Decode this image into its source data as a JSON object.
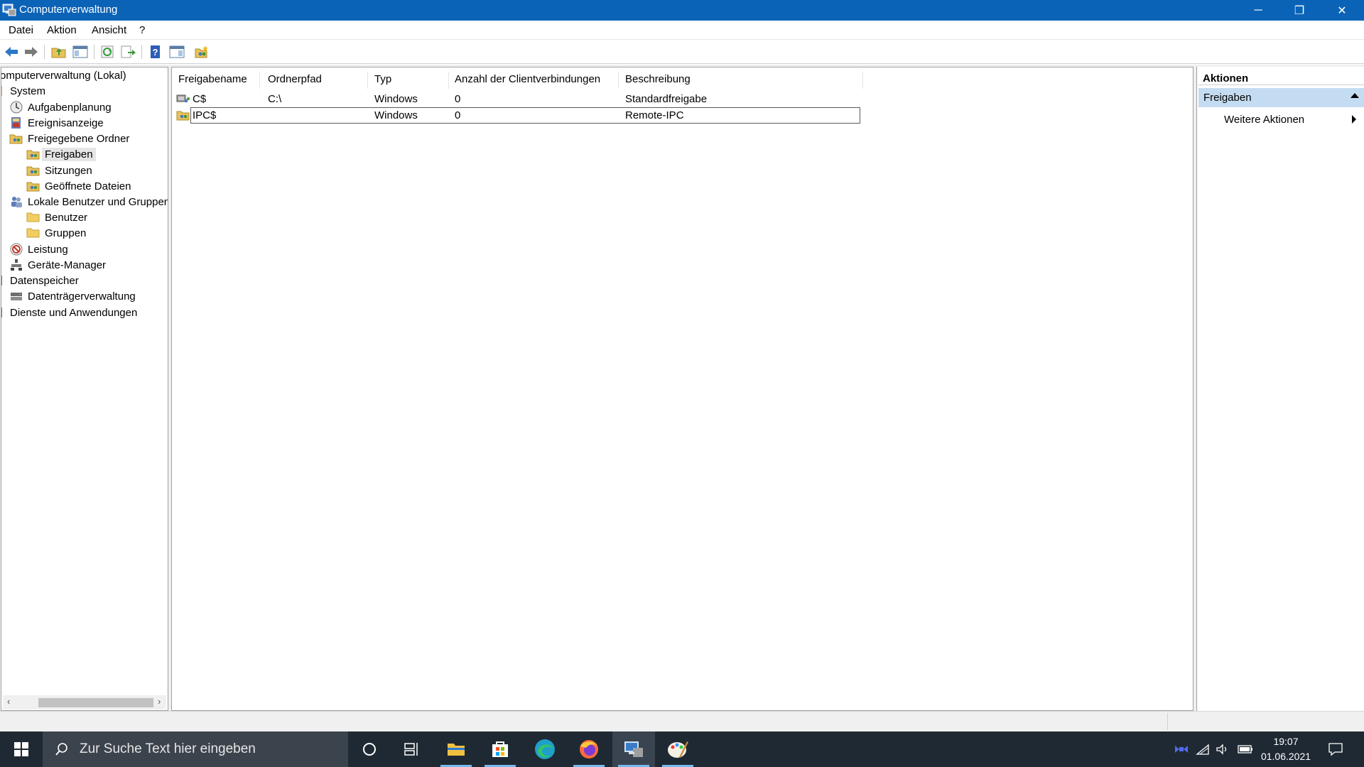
{
  "window": {
    "title": "Computerverwaltung",
    "controls": {
      "minimize": "─",
      "restore": "❐",
      "close": "✕"
    }
  },
  "menu": [
    "Datei",
    "Aktion",
    "Ansicht",
    "?"
  ],
  "toolbar_icons": [
    "back-arrow-icon",
    "forward-arrow-icon",
    "up-folder-icon",
    "show-hide-tree-icon",
    "refresh-icon",
    "export-list-icon",
    "help-icon",
    "show-hide-action-pane-icon",
    "new-share-icon"
  ],
  "tree": {
    "root": "omputerverwaltung (Lokal)",
    "system": "System",
    "task_scheduler": "Aufgabenplanung",
    "event_viewer": "Ereignisanzeige",
    "shared_folders": "Freigegebene Ordner",
    "shares": "Freigaben",
    "sessions": "Sitzungen",
    "open_files": "Geöffnete Dateien",
    "local_users_groups": "Lokale Benutzer und Gruppen",
    "users": "Benutzer",
    "groups": "Gruppen",
    "performance": "Leistung",
    "device_manager": "Geräte-Manager",
    "storage": "Datenspeicher",
    "disk_management": "Datenträgerverwaltung",
    "services_apps": "Dienste und Anwendungen"
  },
  "list": {
    "columns": [
      "Freigabename",
      "Ordnerpfad",
      "Typ",
      "Anzahl der Clientverbindungen",
      "Beschreibung"
    ],
    "rows": [
      {
        "name": "C$",
        "path": "C:\\",
        "type": "Windows",
        "connections": "0",
        "description": "Standardfreigabe"
      },
      {
        "name": "IPC$",
        "path": "",
        "type": "Windows",
        "connections": "0",
        "description": "Remote-IPC"
      }
    ]
  },
  "actions": {
    "header": "Aktionen",
    "group": "Freigaben",
    "more": "Weitere Aktionen"
  },
  "taskbar": {
    "search_placeholder": "Zur Suche Text hier eingeben",
    "time": "19:07",
    "date": "01.06.2021",
    "apps": [
      "cortana-icon",
      "task-view-icon",
      "file-explorer-icon",
      "store-icon",
      "edge-icon",
      "firefox-icon",
      "computer-management-icon",
      "paint-icon"
    ]
  },
  "colors": {
    "titlebar": "#0b63b7",
    "selection": "#c4dcf2",
    "taskbar": "#1f2933"
  }
}
